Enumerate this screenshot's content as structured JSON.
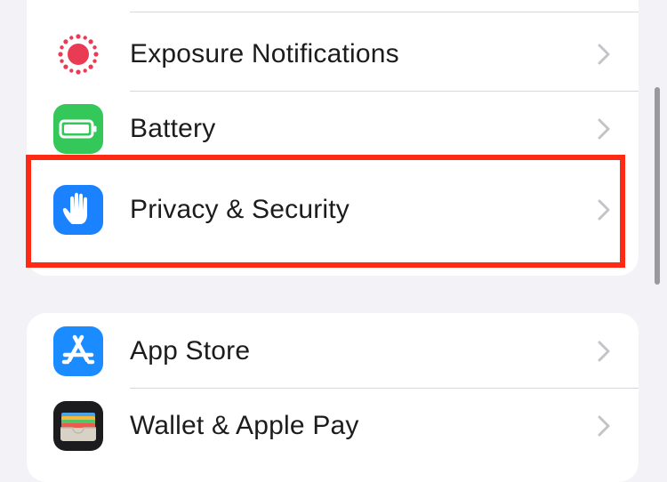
{
  "settings": {
    "group_top": [
      {
        "label": "Exposure Notifications",
        "icon": "exposure-icon",
        "icon_color": "#ffffff",
        "accent": "#ea3b55"
      },
      {
        "label": "Battery",
        "icon": "battery-icon",
        "icon_color": "#34c759"
      },
      {
        "label": "Privacy & Security",
        "icon": "hand-icon",
        "icon_color": "#1a82ff"
      }
    ],
    "group_bottom": [
      {
        "label": "App Store",
        "icon": "app-store-icon",
        "icon_color": "#1a8cff"
      },
      {
        "label": "Wallet & Apple Pay",
        "icon": "wallet-icon",
        "icon_color": "#1c1c1e"
      }
    ]
  },
  "colors": {
    "background": "#f2f2f7",
    "cell": "#ffffff",
    "text": "#1c1c1e",
    "chevron": "#c4c4c8",
    "highlight": "#ff2a14"
  }
}
